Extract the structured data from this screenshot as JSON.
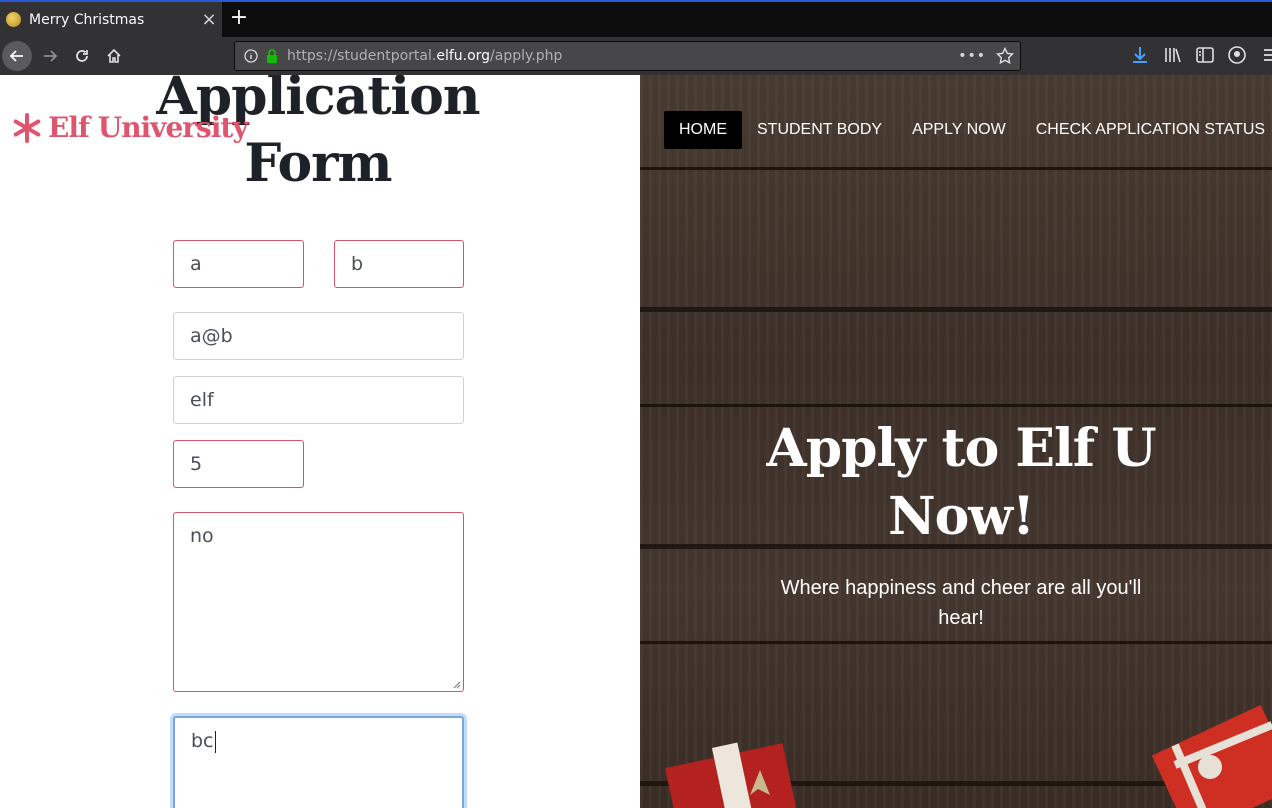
{
  "browser": {
    "tab_title": "Merry Christmas",
    "tab_close": "×",
    "new_tab": "+",
    "url_prefix": "https://studentportal.",
    "url_domain": "elfu.org",
    "url_path": "/apply.php",
    "url_more": "•••"
  },
  "brand": {
    "name": "Elf University",
    "color": "#e0556e"
  },
  "form": {
    "title_line1": "Application",
    "title_line2": "Form",
    "first_name": "a",
    "last_name": "b",
    "email": "a@b",
    "major": "elf",
    "age": "5",
    "textarea_one": "no",
    "textarea_two": "bc"
  },
  "nav": {
    "items": [
      "HOME",
      "STUDENT BODY",
      "APPLY NOW",
      "CHECK APPLICATION STATUS"
    ]
  },
  "hero": {
    "title_line1": "Apply to Elf U",
    "title_line2": "Now!",
    "subtitle": "Where happiness and cheer are all you'll hear!"
  },
  "colors": {
    "invalid_border": "#d9536b",
    "focus_border": "#7fa4d6",
    "active_nav": "#000000"
  }
}
